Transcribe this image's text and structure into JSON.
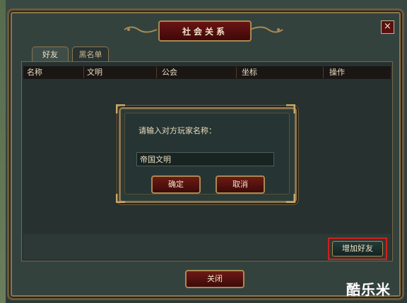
{
  "window": {
    "title": "社会关系",
    "close_icon": "×"
  },
  "tabs": [
    {
      "label": "好友",
      "active": true
    },
    {
      "label": "黑名单",
      "active": false
    }
  ],
  "table": {
    "columns": [
      "名称",
      "文明",
      "公会",
      "坐标",
      "操作"
    ],
    "rows": []
  },
  "buttons": {
    "add_friend": "增加好友",
    "close": "关闭"
  },
  "dialog": {
    "prompt": "请输入对方玩家名称：",
    "input_value": "帝国文明",
    "ok": "确定",
    "cancel": "取消"
  },
  "watermark": "酷乐米",
  "colors": {
    "accent_red": "#d2201c",
    "gold_frame": "#a88a52",
    "panel": "#2b3b38"
  }
}
